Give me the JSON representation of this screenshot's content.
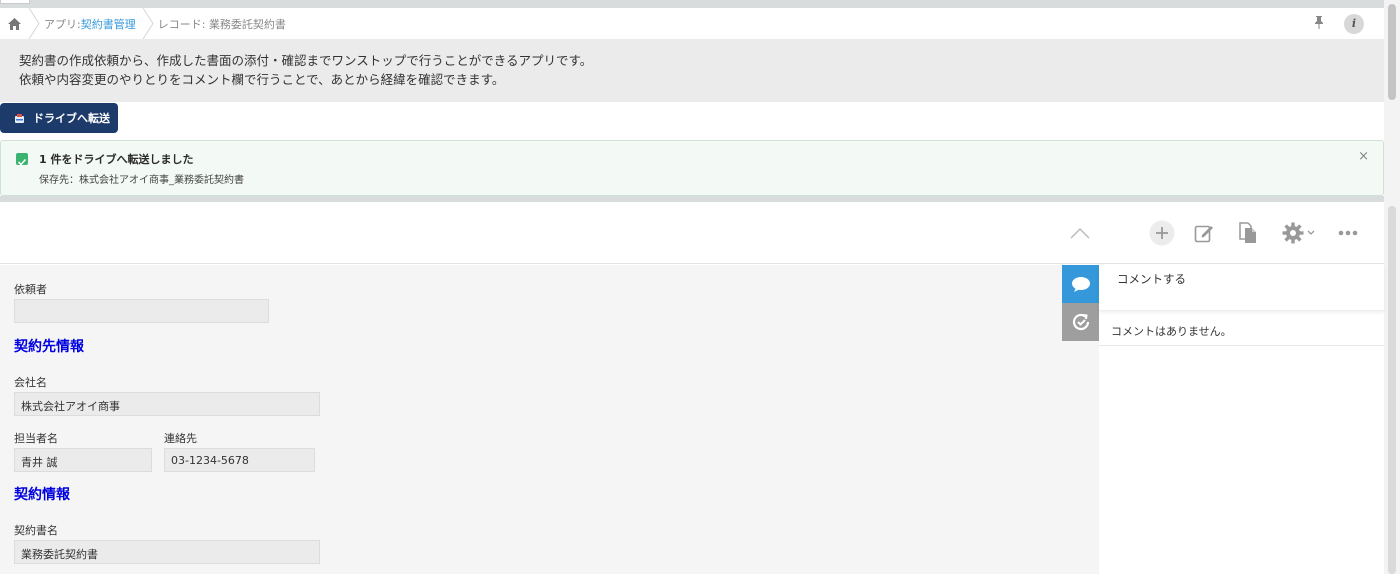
{
  "breadcrumb": {
    "app_prefix": "アプリ: ",
    "app_name": "契約書管理",
    "record_label": "レコード: 業務委託契約書"
  },
  "description": {
    "line1": "契約書の作成依頼から、作成した書面の添付・確認までワンストップで行うことができるアプリです。",
    "line2": "依頼や内容変更のやりとりをコメント欄で行うことで、あとから経緯を確認できます。"
  },
  "drive_button": {
    "label": "ドライブへ転送"
  },
  "notice": {
    "title": "1 件をドライブへ転送しました",
    "detail": "保存先：株式会社アオイ商事_業務委託契約書",
    "close": "×"
  },
  "header_info": {
    "label": "i"
  },
  "record": {
    "requester_label": "依頼者",
    "requester_value": "",
    "section_partner": "契約先情報",
    "company_label": "会社名",
    "company_value": "株式会社アオイ商事",
    "contact_person_label": "担当者名",
    "contact_person_value": "青井 誠",
    "phone_label": "連絡先",
    "phone_value": "03-1234-5678",
    "section_contract": "契約情報",
    "contract_name_label": "契約書名",
    "contract_name_value": "業務委託契約書"
  },
  "comments": {
    "input_placeholder": "コメントする",
    "empty_message": "コメントはありません。"
  },
  "colors": {
    "accent_blue": "#1c3b6a",
    "link_blue": "#3498db",
    "section_title": "#0000e0",
    "comment_tab": "#3498db",
    "history_tab": "#9e9e9e",
    "success_green": "#3cb371"
  }
}
